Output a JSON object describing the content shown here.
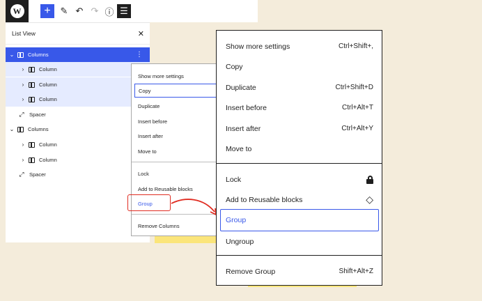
{
  "toolbar": {
    "logo_letter": "W",
    "buttons": [
      {
        "name": "add-block-button",
        "icon": "plus-icon",
        "glyph": "+"
      },
      {
        "name": "tools-button",
        "icon": "pencil-icon",
        "glyph": "✎"
      },
      {
        "name": "undo-button",
        "icon": "undo-icon",
        "glyph": "↶"
      },
      {
        "name": "redo-button",
        "icon": "redo-icon",
        "glyph": "↷"
      },
      {
        "name": "details-button",
        "icon": "info-icon",
        "glyph": "ⓘ"
      },
      {
        "name": "list-view-button",
        "icon": "list-view-icon",
        "glyph": "☰"
      }
    ]
  },
  "list_view": {
    "title": "List View",
    "close_glyph": "✕",
    "more_glyph": "⋮",
    "rows": [
      {
        "label": "Columns",
        "chevron": "⌄",
        "icon": "columns-icon"
      },
      {
        "label": "Column",
        "chevron": "›",
        "icon": "column-icon"
      },
      {
        "label": "Column",
        "chevron": "›",
        "icon": "column-icon"
      },
      {
        "label": "Column",
        "chevron": "›",
        "icon": "column-icon"
      },
      {
        "label": "Spacer",
        "chevron": "",
        "icon": "spacer-icon",
        "glyph": "⤢"
      },
      {
        "label": "Columns",
        "chevron": "⌄",
        "icon": "columns-icon"
      },
      {
        "label": "Column",
        "chevron": "›",
        "icon": "column-icon"
      },
      {
        "label": "Column",
        "chevron": "›",
        "icon": "column-icon"
      },
      {
        "label": "Spacer",
        "chevron": "",
        "icon": "spacer-icon",
        "glyph": "⤢"
      }
    ]
  },
  "small_menu": {
    "items": [
      "Show more settings",
      "Copy",
      "Duplicate",
      "Insert before",
      "Insert after",
      "Move to",
      "Lock",
      "Add to Reusable blocks",
      "Group",
      "Remove Columns"
    ]
  },
  "big_menu": {
    "items": [
      {
        "label": "Show more settings",
        "shortcut": "Ctrl+Shift+,"
      },
      {
        "label": "Copy",
        "shortcut": ""
      },
      {
        "label": "Duplicate",
        "shortcut": "Ctrl+Shift+D"
      },
      {
        "label": "Insert before",
        "shortcut": "Ctrl+Alt+T"
      },
      {
        "label": "Insert after",
        "shortcut": "Ctrl+Alt+Y"
      },
      {
        "label": "Move to",
        "shortcut": ""
      },
      {
        "label": "Lock",
        "icon": "lock-icon"
      },
      {
        "label": "Add to Reusable blocks",
        "icon": "reusable-block-icon",
        "glyph": "◇"
      },
      {
        "label": "Group",
        "shortcut": ""
      },
      {
        "label": "Ungroup",
        "shortcut": ""
      },
      {
        "label": "Remove Group",
        "shortcut": "Shift+Alt+Z"
      }
    ]
  },
  "colors": {
    "accent": "#3858e9",
    "highlight": "#e02b20",
    "background": "#f4ecdb",
    "selected_row_tint": "#e5ebff",
    "block_yellow": "#fbe57a"
  }
}
